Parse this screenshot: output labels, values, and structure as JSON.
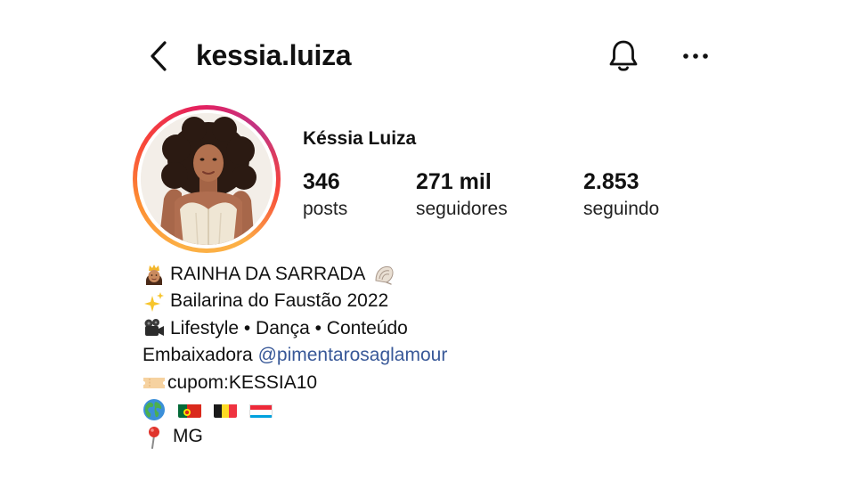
{
  "header": {
    "username": "kessia.luiza",
    "back_icon": "chevron-left-icon",
    "bell_icon": "bell-icon",
    "more_icon": "more-horizontal-icon"
  },
  "profile": {
    "full_name": "Késsia Luiza",
    "stats": [
      {
        "value": "346",
        "label": "posts"
      },
      {
        "value": "271 mil",
        "label": "seguidores"
      },
      {
        "value": "2.853",
        "label": "seguindo"
      }
    ],
    "ring_colors": [
      "#fcb045",
      "#f7433a",
      "#c13584"
    ]
  },
  "bio": {
    "line1": "RAINHA DA SARRADA",
    "line2": "Bailarina do Faustão 2022",
    "line3": "Lifestyle • Dança • Conteúdo",
    "line4_prefix": "Embaixadora ",
    "line4_mention": "@pimentarosaglamour",
    "line5": "cupom:KESSIA10",
    "line7": "MG",
    "mention_color": "#385898",
    "emojis": [
      "princess-emoji",
      "shell-emoji",
      "sparkles-emoji",
      "video-camera-emoji",
      "ticket-emoji",
      "globe-emoji",
      "pushpin-emoji"
    ],
    "flags": [
      "portugal-flag",
      "belgium-flag",
      "luxembourg-flag"
    ]
  }
}
